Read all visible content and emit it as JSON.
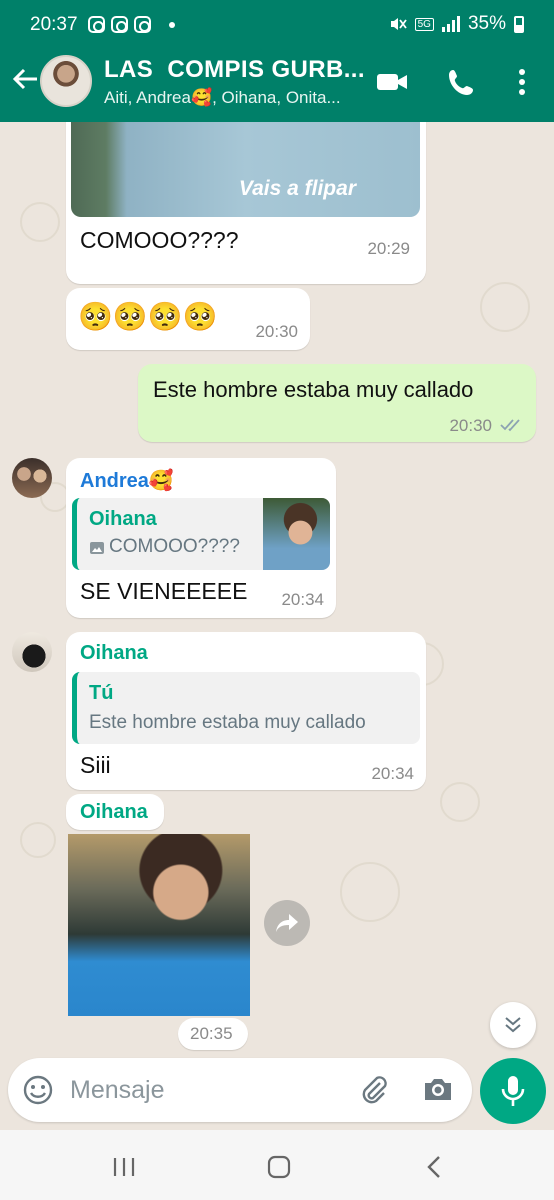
{
  "status_bar": {
    "time": "20:37",
    "network": "5G",
    "battery": "35%"
  },
  "header": {
    "group_name": "LAS  COMPIS GURB...",
    "members": "Aiti, Andrea🥰, Oihana, Onita..."
  },
  "messages": [
    {
      "type": "image_caption",
      "image_overlay": "Vais a flipar",
      "text": "COMOOO????",
      "time": "20:29"
    },
    {
      "type": "emoji",
      "text": "🥺🥺🥺🥺",
      "time": "20:30"
    },
    {
      "type": "outgoing",
      "text": "Este hombre estaba muy callado",
      "time": "20:30",
      "status": "read"
    },
    {
      "type": "reply",
      "sender": "Andrea🥰",
      "quoted_name": "Oihana",
      "quoted_text": "COMOOO????",
      "text": "SE VIENEEEEE",
      "time": "20:34"
    },
    {
      "type": "reply",
      "sender": "Oihana",
      "quoted_name": "Tú",
      "quoted_text": "Este hombre estaba muy callado",
      "text": "Siii",
      "time": "20:34"
    },
    {
      "type": "image",
      "sender": "Oihana",
      "time": "20:35"
    }
  ],
  "input": {
    "placeholder": "Mensaje"
  },
  "colors": {
    "header": "#008069",
    "accent": "#00a884",
    "outgoing_bubble": "#dcf8c6",
    "andrea_name": "#1e7ad8",
    "oihana_name": "#00a884"
  },
  "icons": [
    "back-arrow-icon",
    "video-call-icon",
    "phone-icon",
    "more-options-icon",
    "emoji-icon",
    "attach-icon",
    "camera-icon",
    "mic-icon",
    "forward-icon",
    "scroll-down-icon",
    "read-checks-icon"
  ]
}
